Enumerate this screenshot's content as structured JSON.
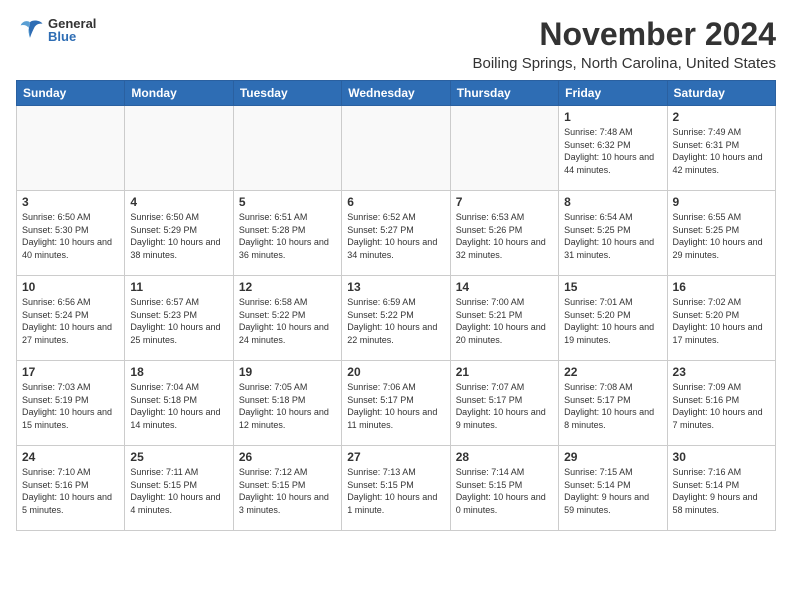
{
  "logo": {
    "general": "General",
    "blue": "Blue"
  },
  "header": {
    "month": "November 2024",
    "location": "Boiling Springs, North Carolina, United States"
  },
  "weekdays": [
    "Sunday",
    "Monday",
    "Tuesday",
    "Wednesday",
    "Thursday",
    "Friday",
    "Saturday"
  ],
  "weeks": [
    [
      {
        "day": "",
        "info": ""
      },
      {
        "day": "",
        "info": ""
      },
      {
        "day": "",
        "info": ""
      },
      {
        "day": "",
        "info": ""
      },
      {
        "day": "",
        "info": ""
      },
      {
        "day": "1",
        "info": "Sunrise: 7:48 AM\nSunset: 6:32 PM\nDaylight: 10 hours and 44 minutes."
      },
      {
        "day": "2",
        "info": "Sunrise: 7:49 AM\nSunset: 6:31 PM\nDaylight: 10 hours and 42 minutes."
      }
    ],
    [
      {
        "day": "3",
        "info": "Sunrise: 6:50 AM\nSunset: 5:30 PM\nDaylight: 10 hours and 40 minutes."
      },
      {
        "day": "4",
        "info": "Sunrise: 6:50 AM\nSunset: 5:29 PM\nDaylight: 10 hours and 38 minutes."
      },
      {
        "day": "5",
        "info": "Sunrise: 6:51 AM\nSunset: 5:28 PM\nDaylight: 10 hours and 36 minutes."
      },
      {
        "day": "6",
        "info": "Sunrise: 6:52 AM\nSunset: 5:27 PM\nDaylight: 10 hours and 34 minutes."
      },
      {
        "day": "7",
        "info": "Sunrise: 6:53 AM\nSunset: 5:26 PM\nDaylight: 10 hours and 32 minutes."
      },
      {
        "day": "8",
        "info": "Sunrise: 6:54 AM\nSunset: 5:25 PM\nDaylight: 10 hours and 31 minutes."
      },
      {
        "day": "9",
        "info": "Sunrise: 6:55 AM\nSunset: 5:25 PM\nDaylight: 10 hours and 29 minutes."
      }
    ],
    [
      {
        "day": "10",
        "info": "Sunrise: 6:56 AM\nSunset: 5:24 PM\nDaylight: 10 hours and 27 minutes."
      },
      {
        "day": "11",
        "info": "Sunrise: 6:57 AM\nSunset: 5:23 PM\nDaylight: 10 hours and 25 minutes."
      },
      {
        "day": "12",
        "info": "Sunrise: 6:58 AM\nSunset: 5:22 PM\nDaylight: 10 hours and 24 minutes."
      },
      {
        "day": "13",
        "info": "Sunrise: 6:59 AM\nSunset: 5:22 PM\nDaylight: 10 hours and 22 minutes."
      },
      {
        "day": "14",
        "info": "Sunrise: 7:00 AM\nSunset: 5:21 PM\nDaylight: 10 hours and 20 minutes."
      },
      {
        "day": "15",
        "info": "Sunrise: 7:01 AM\nSunset: 5:20 PM\nDaylight: 10 hours and 19 minutes."
      },
      {
        "day": "16",
        "info": "Sunrise: 7:02 AM\nSunset: 5:20 PM\nDaylight: 10 hours and 17 minutes."
      }
    ],
    [
      {
        "day": "17",
        "info": "Sunrise: 7:03 AM\nSunset: 5:19 PM\nDaylight: 10 hours and 15 minutes."
      },
      {
        "day": "18",
        "info": "Sunrise: 7:04 AM\nSunset: 5:18 PM\nDaylight: 10 hours and 14 minutes."
      },
      {
        "day": "19",
        "info": "Sunrise: 7:05 AM\nSunset: 5:18 PM\nDaylight: 10 hours and 12 minutes."
      },
      {
        "day": "20",
        "info": "Sunrise: 7:06 AM\nSunset: 5:17 PM\nDaylight: 10 hours and 11 minutes."
      },
      {
        "day": "21",
        "info": "Sunrise: 7:07 AM\nSunset: 5:17 PM\nDaylight: 10 hours and 9 minutes."
      },
      {
        "day": "22",
        "info": "Sunrise: 7:08 AM\nSunset: 5:17 PM\nDaylight: 10 hours and 8 minutes."
      },
      {
        "day": "23",
        "info": "Sunrise: 7:09 AM\nSunset: 5:16 PM\nDaylight: 10 hours and 7 minutes."
      }
    ],
    [
      {
        "day": "24",
        "info": "Sunrise: 7:10 AM\nSunset: 5:16 PM\nDaylight: 10 hours and 5 minutes."
      },
      {
        "day": "25",
        "info": "Sunrise: 7:11 AM\nSunset: 5:15 PM\nDaylight: 10 hours and 4 minutes."
      },
      {
        "day": "26",
        "info": "Sunrise: 7:12 AM\nSunset: 5:15 PM\nDaylight: 10 hours and 3 minutes."
      },
      {
        "day": "27",
        "info": "Sunrise: 7:13 AM\nSunset: 5:15 PM\nDaylight: 10 hours and 1 minute."
      },
      {
        "day": "28",
        "info": "Sunrise: 7:14 AM\nSunset: 5:15 PM\nDaylight: 10 hours and 0 minutes."
      },
      {
        "day": "29",
        "info": "Sunrise: 7:15 AM\nSunset: 5:14 PM\nDaylight: 9 hours and 59 minutes."
      },
      {
        "day": "30",
        "info": "Sunrise: 7:16 AM\nSunset: 5:14 PM\nDaylight: 9 hours and 58 minutes."
      }
    ]
  ]
}
